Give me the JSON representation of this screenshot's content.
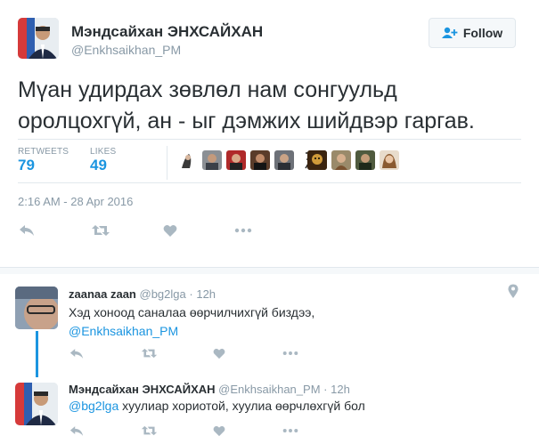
{
  "author": {
    "name": "Мэндсайхан ЭНХСАЙХАН",
    "handle": "@Enkhsaikhan_PM"
  },
  "follow_label": "Follow",
  "tweet": {
    "text_line1": "Мүан удирдах зөвлөл нам сонгуульд",
    "text_line2": "оролцохгүй, ан - ыг дэмжих шийдвэр гаргав.",
    "retweets_label": "RETWEETS",
    "retweets_count": "79",
    "likes_label": "LIKES",
    "likes_count": "49",
    "timestamp": "2:16 AM - 28 Apr 2016"
  },
  "replies": [
    {
      "name": "zaanaa zaan",
      "handle": "@bg2lga",
      "sep": "·",
      "time": "12h",
      "text": "Хэд хоноод саналаа өөрчилчихгүй биздээ,",
      "mention": "@Enkhsaikhan_PM"
    },
    {
      "name": "Мэндсайхан ЭНХСАЙХАН",
      "handle": "@Enkhsaikhan_PM",
      "sep": "·",
      "time": "12h",
      "mention": "@bg2lga",
      "text": " хуулиар хориотой, хуулиа өөрчлөхгүй бол"
    }
  ],
  "icons": {
    "reply": "reply-icon",
    "retweet": "retweet-icon",
    "like": "heart-icon",
    "more": "more-icon",
    "location": "location-pin-icon",
    "follow": "add-user-icon"
  },
  "colors": {
    "link": "#1b95e0",
    "muted": "#8899a6",
    "text": "#292f33",
    "divider": "#e1e8ed"
  }
}
